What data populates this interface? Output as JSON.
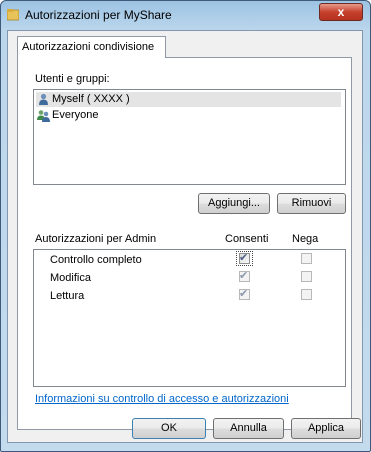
{
  "window": {
    "title": "Autorizzazioni per MyShare",
    "close_label": "x"
  },
  "tab": {
    "label": "Autorizzazioni condivisione"
  },
  "users": {
    "label": "Utenti e gruppi:",
    "items": [
      {
        "name": "Myself ( XXXX )",
        "selected": true,
        "icon": "user-icon"
      },
      {
        "name": "Everyone",
        "selected": false,
        "icon": "users-group-icon"
      }
    ],
    "add_button": "Aggiungi...",
    "remove_button": "Rimuovi"
  },
  "permissions": {
    "header": "Autorizzazioni per Admin",
    "allow_header": "Consenti",
    "deny_header": "Nega",
    "rows": [
      {
        "name": "Controllo completo",
        "allow": true,
        "allow_enabled": true,
        "deny": false
      },
      {
        "name": "Modifica",
        "allow": true,
        "allow_enabled": false,
        "deny": false
      },
      {
        "name": "Lettura",
        "allow": true,
        "allow_enabled": false,
        "deny": false
      }
    ]
  },
  "link": "Informazioni su controllo di accesso e autorizzazioni",
  "buttons": {
    "ok": "OK",
    "cancel": "Annulla",
    "apply": "Applica"
  },
  "colors": {
    "link": "#0066cc",
    "close_button": "#c5412d",
    "title_bar": "#9cc3e3"
  }
}
